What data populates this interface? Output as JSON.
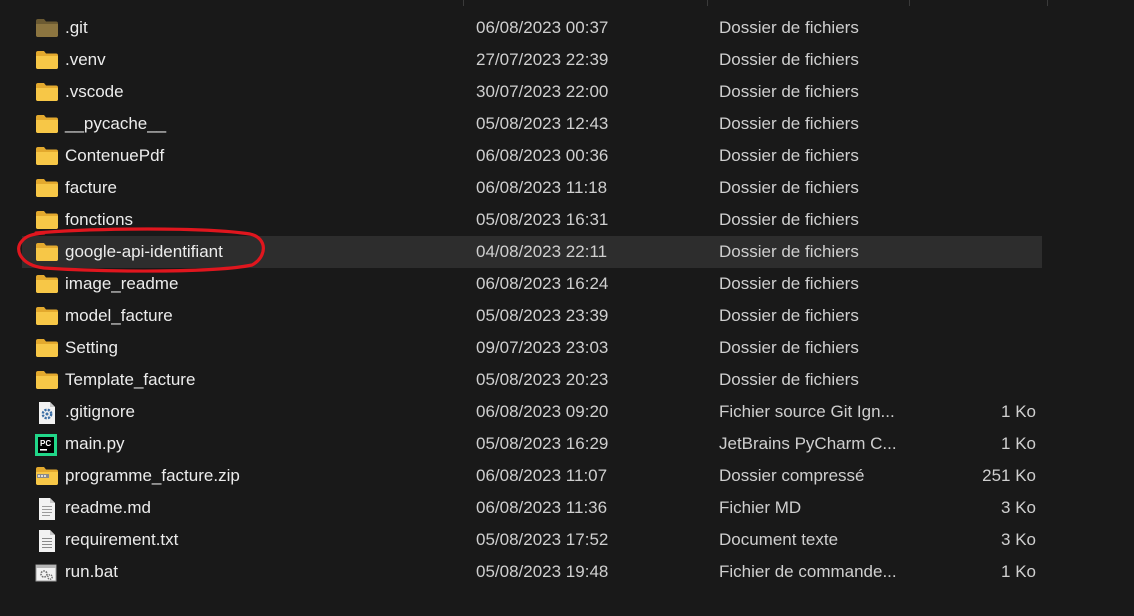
{
  "files": [
    {
      "name": ".git",
      "date": "06/08/2023 00:37",
      "type": "Dossier de fichiers",
      "size": "",
      "icon": "folder-dark-icon"
    },
    {
      "name": ".venv",
      "date": "27/07/2023 22:39",
      "type": "Dossier de fichiers",
      "size": "",
      "icon": "folder-icon"
    },
    {
      "name": ".vscode",
      "date": "30/07/2023 22:00",
      "type": "Dossier de fichiers",
      "size": "",
      "icon": "folder-icon"
    },
    {
      "name": "__pycache__",
      "date": "05/08/2023 12:43",
      "type": "Dossier de fichiers",
      "size": "",
      "icon": "folder-icon"
    },
    {
      "name": "ContenuePdf",
      "date": "06/08/2023 00:36",
      "type": "Dossier de fichiers",
      "size": "",
      "icon": "folder-icon"
    },
    {
      "name": "facture",
      "date": "06/08/2023 11:18",
      "type": "Dossier de fichiers",
      "size": "",
      "icon": "folder-icon"
    },
    {
      "name": "fonctions",
      "date": "05/08/2023 16:31",
      "type": "Dossier de fichiers",
      "size": "",
      "icon": "folder-icon"
    },
    {
      "name": "google-api-identifiant",
      "date": "04/08/2023 22:11",
      "type": "Dossier de fichiers",
      "size": "",
      "icon": "folder-icon",
      "selected": true
    },
    {
      "name": "image_readme",
      "date": "06/08/2023 16:24",
      "type": "Dossier de fichiers",
      "size": "",
      "icon": "folder-icon"
    },
    {
      "name": "model_facture",
      "date": "05/08/2023 23:39",
      "type": "Dossier de fichiers",
      "size": "",
      "icon": "folder-icon"
    },
    {
      "name": "Setting",
      "date": "09/07/2023 23:03",
      "type": "Dossier de fichiers",
      "size": "",
      "icon": "folder-icon"
    },
    {
      "name": "Template_facture",
      "date": "05/08/2023 20:23",
      "type": "Dossier de fichiers",
      "size": "",
      "icon": "folder-icon"
    },
    {
      "name": ".gitignore",
      "date": "06/08/2023 09:20",
      "type": "Fichier source Git Ign...",
      "size": "1 Ko",
      "icon": "gear-file-icon"
    },
    {
      "name": "main.py",
      "date": "05/08/2023 16:29",
      "type": "JetBrains PyCharm C...",
      "size": "1 Ko",
      "icon": "pycharm-icon"
    },
    {
      "name": "programme_facture.zip",
      "date": "06/08/2023 11:07",
      "type": "Dossier compressé",
      "size": "251 Ko",
      "icon": "zip-folder-icon"
    },
    {
      "name": "readme.md",
      "date": "06/08/2023 11:36",
      "type": "Fichier MD",
      "size": "3 Ko",
      "icon": "document-icon"
    },
    {
      "name": "requirement.txt",
      "date": "05/08/2023 17:52",
      "type": "Document texte",
      "size": "3 Ko",
      "icon": "text-document-icon"
    },
    {
      "name": "run.bat",
      "date": "05/08/2023 19:48",
      "type": "Fichier de commande...",
      "size": "1 Ko",
      "icon": "batch-file-icon"
    }
  ],
  "colors": {
    "background": "#191919",
    "selected_row": "#2d2d2d",
    "folder": "#f5c342",
    "highlight_ellipse": "#e0161e"
  }
}
